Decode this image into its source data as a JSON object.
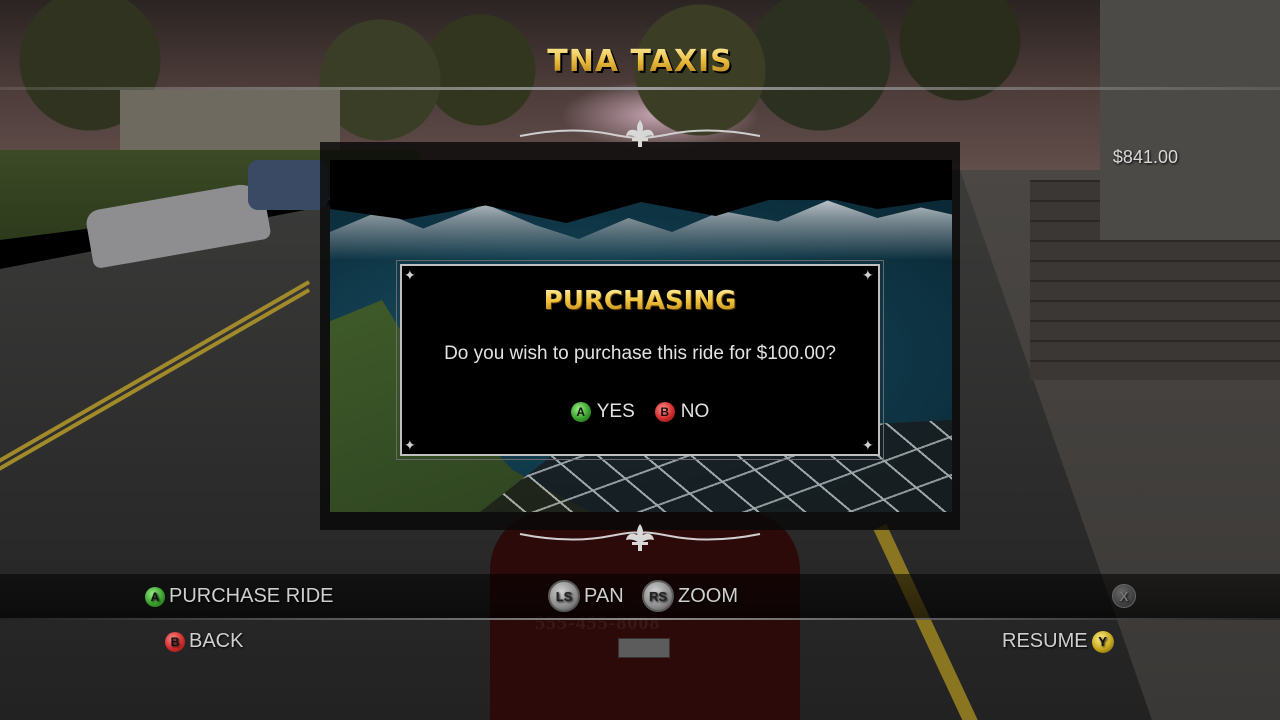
{
  "header": {
    "title": "TNA TAXIS",
    "money": "$841.00"
  },
  "map": {
    "taxi_number": "555-455-8008"
  },
  "dialog": {
    "title": "PURCHASING",
    "message": "Do you wish to purchase this ride for $100.00?",
    "yes_button": "A",
    "yes_label": "YES",
    "no_button": "B",
    "no_label": "NO"
  },
  "footer": {
    "purchase": {
      "button": "A",
      "label": "PURCHASE RIDE"
    },
    "pan": {
      "button": "LS",
      "label": "PAN"
    },
    "zoom": {
      "button": "RS",
      "label": "ZOOM"
    },
    "close": {
      "button": "X"
    },
    "back": {
      "button": "B",
      "label": "BACK"
    },
    "resume": {
      "button": "Y",
      "label": "RESUME"
    }
  },
  "colors": {
    "title_gold": "#e8b93a",
    "button_a": "#3aa12c",
    "button_b": "#d22c2c",
    "button_y": "#c6a81c"
  },
  "icons": {
    "ornament": "fleur-de-lis-icon"
  }
}
